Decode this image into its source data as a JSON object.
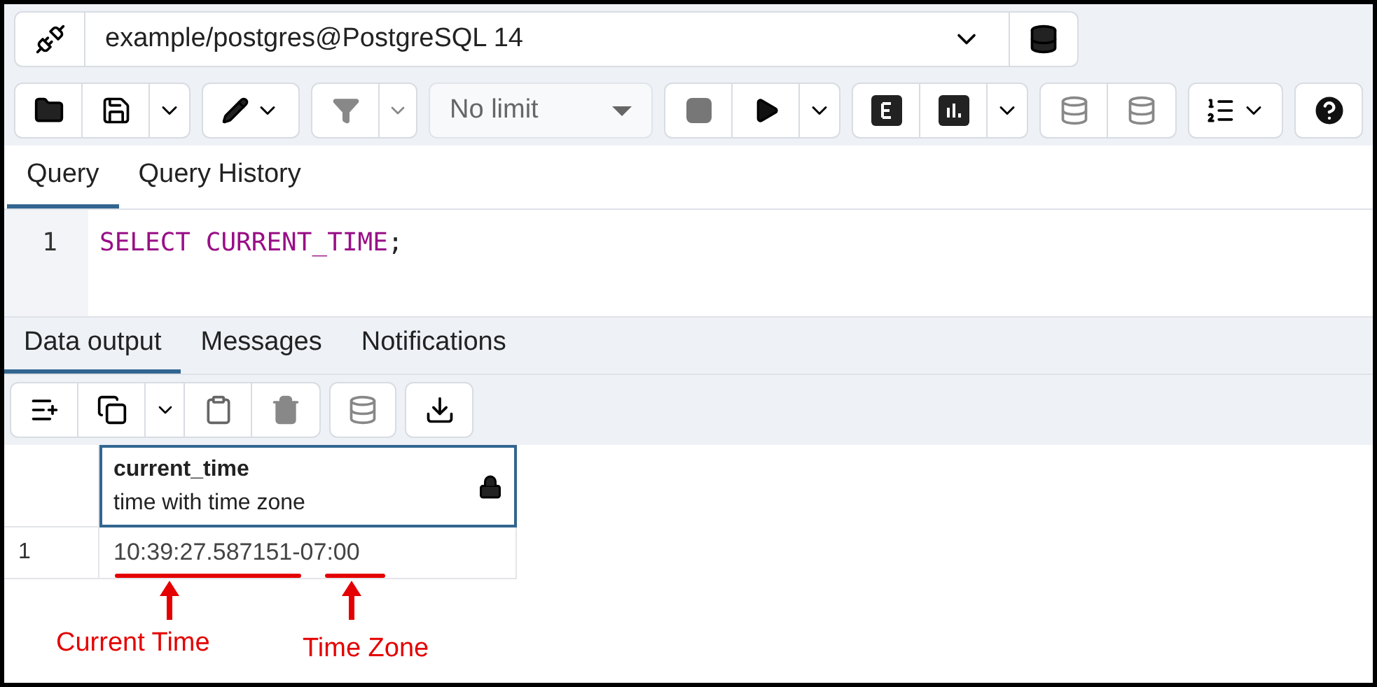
{
  "connection": {
    "value": "example/postgres@PostgreSQL 14"
  },
  "toolbar": {
    "limit": "No limit"
  },
  "query_tabs": [
    {
      "label": "Query",
      "selected": true
    },
    {
      "label": "Query History",
      "selected": false
    }
  ],
  "editor": {
    "lines": [
      {
        "number": "1",
        "tokens": [
          {
            "kind": "keyword",
            "text": "SELECT"
          },
          {
            "kind": "keyword",
            "text": "CURRENT_TIME"
          },
          {
            "kind": "punct",
            "text": ";"
          }
        ]
      }
    ]
  },
  "output_tabs": [
    {
      "label": "Data output",
      "selected": true
    },
    {
      "label": "Messages",
      "selected": false
    },
    {
      "label": "Notifications",
      "selected": false
    }
  ],
  "table": {
    "columns": [
      {
        "name": "current_time",
        "type": "time with time zone",
        "locked": true
      }
    ],
    "rows": [
      {
        "number": "1",
        "cells": [
          "10:39:27.587151-07:00"
        ]
      }
    ]
  },
  "annotations": [
    {
      "label": "Current Time"
    },
    {
      "label": "Time Zone"
    }
  ]
}
